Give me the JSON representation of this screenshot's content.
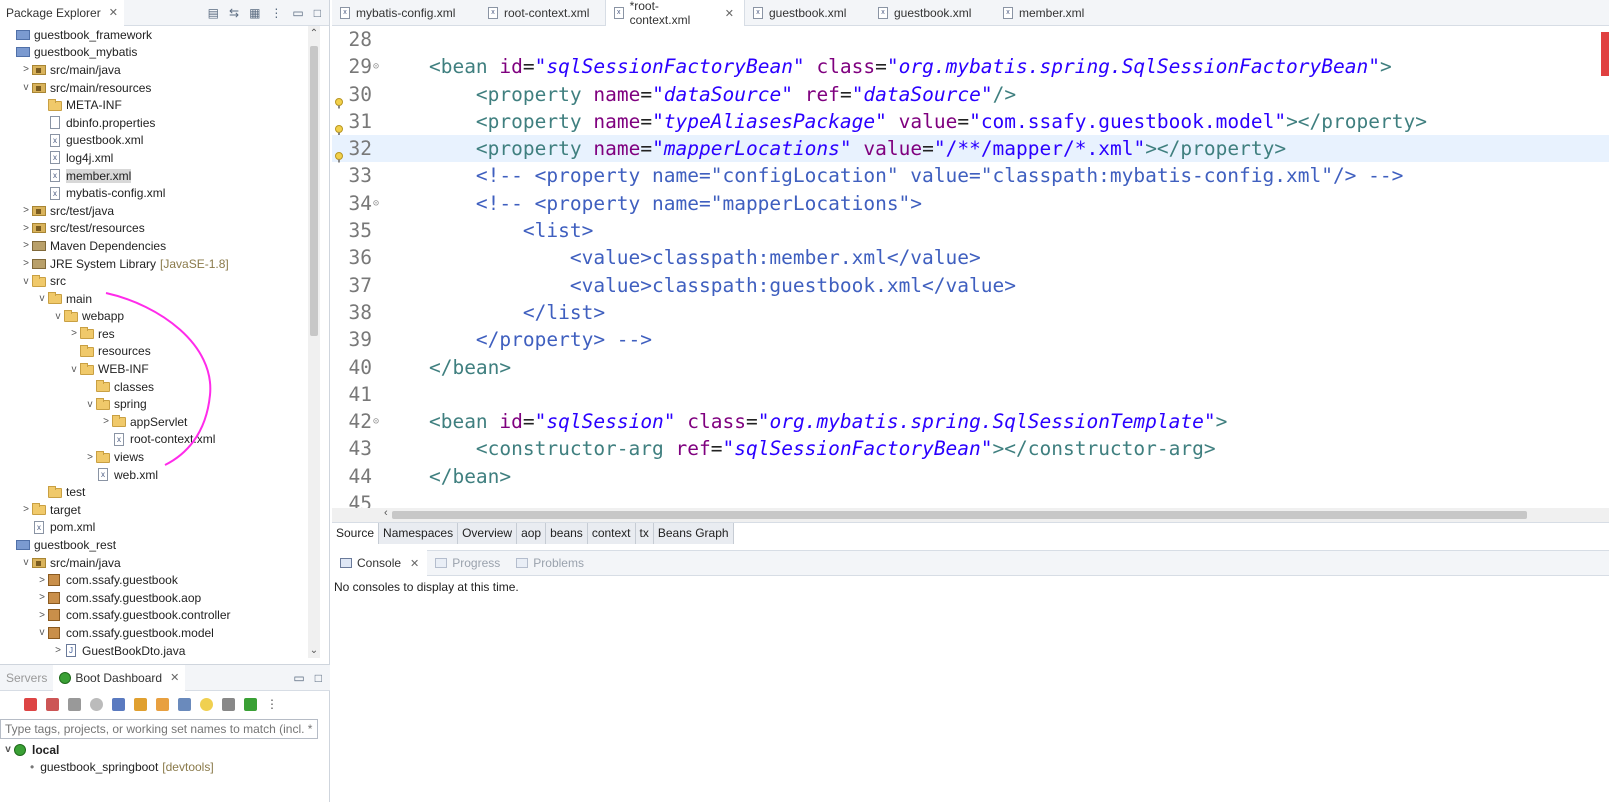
{
  "package_explorer": {
    "tab_label": "Package Explorer",
    "tree": [
      {
        "depth": 0,
        "twisty": "",
        "icon": "project-icon",
        "label": "guestbook_framework"
      },
      {
        "depth": 0,
        "twisty": "",
        "icon": "project-icon",
        "label": "guestbook_mybatis"
      },
      {
        "depth": 1,
        "twisty": ">",
        "icon": "srcfolder-icon",
        "label": "src/main/java"
      },
      {
        "depth": 1,
        "twisty": "v",
        "icon": "srcfolder-icon",
        "label": "src/main/resources"
      },
      {
        "depth": 2,
        "twisty": "",
        "icon": "folder-icon",
        "label": "META-INF"
      },
      {
        "depth": 2,
        "twisty": "",
        "icon": "file-icon",
        "label": "dbinfo.properties"
      },
      {
        "depth": 2,
        "twisty": "",
        "icon": "xml-file-icon",
        "label": "guestbook.xml"
      },
      {
        "depth": 2,
        "twisty": "",
        "icon": "xml-file-icon",
        "label": "log4j.xml"
      },
      {
        "depth": 2,
        "twisty": "",
        "icon": "xml-file-icon",
        "label": "member.xml",
        "selected": true
      },
      {
        "depth": 2,
        "twisty": "",
        "icon": "xml-file-icon",
        "label": "mybatis-config.xml"
      },
      {
        "depth": 1,
        "twisty": ">",
        "icon": "srcfolder-icon",
        "label": "src/test/java"
      },
      {
        "depth": 1,
        "twisty": ">",
        "icon": "srcfolder-icon",
        "label": "src/test/resources"
      },
      {
        "depth": 1,
        "twisty": ">",
        "icon": "library-icon",
        "label": "Maven Dependencies"
      },
      {
        "depth": 1,
        "twisty": ">",
        "icon": "library-icon",
        "label": "JRE System Library",
        "decoration": "[JavaSE-1.8]"
      },
      {
        "depth": 1,
        "twisty": "v",
        "icon": "folder-icon",
        "label": "src"
      },
      {
        "depth": 2,
        "twisty": "v",
        "icon": "folder-icon",
        "label": "main"
      },
      {
        "depth": 3,
        "twisty": "v",
        "icon": "folder-icon",
        "label": "webapp"
      },
      {
        "depth": 4,
        "twisty": ">",
        "icon": "folder-icon",
        "label": "res"
      },
      {
        "depth": 4,
        "twisty": "",
        "icon": "folder-icon",
        "label": "resources"
      },
      {
        "depth": 4,
        "twisty": "v",
        "icon": "folder-icon",
        "label": "WEB-INF"
      },
      {
        "depth": 5,
        "twisty": "",
        "icon": "folder-icon",
        "label": "classes"
      },
      {
        "depth": 5,
        "twisty": "v",
        "icon": "folder-icon",
        "label": "spring"
      },
      {
        "depth": 6,
        "twisty": ">",
        "icon": "folder-icon",
        "label": "appServlet"
      },
      {
        "depth": 6,
        "twisty": "",
        "icon": "xml-file-icon",
        "label": "root-context.xml"
      },
      {
        "depth": 5,
        "twisty": ">",
        "icon": "folder-icon",
        "label": "views"
      },
      {
        "depth": 5,
        "twisty": "",
        "icon": "xml-file-icon",
        "label": "web.xml"
      },
      {
        "depth": 2,
        "twisty": "",
        "icon": "folder-icon",
        "label": "test"
      },
      {
        "depth": 1,
        "twisty": ">",
        "icon": "folder-icon",
        "label": "target"
      },
      {
        "depth": 1,
        "twisty": "",
        "icon": "xml-file-icon",
        "label": "pom.xml"
      },
      {
        "depth": 0,
        "twisty": "",
        "icon": "project-icon",
        "label": "guestbook_rest"
      },
      {
        "depth": 1,
        "twisty": "v",
        "icon": "srcfolder-icon",
        "label": "src/main/java"
      },
      {
        "depth": 2,
        "twisty": ">",
        "icon": "package-icon",
        "label": "com.ssafy.guestbook"
      },
      {
        "depth": 2,
        "twisty": ">",
        "icon": "package-icon",
        "label": "com.ssafy.guestbook.aop"
      },
      {
        "depth": 2,
        "twisty": ">",
        "icon": "package-icon",
        "label": "com.ssafy.guestbook.controller"
      },
      {
        "depth": 2,
        "twisty": "v",
        "icon": "package-icon",
        "label": "com.ssafy.guestbook.model"
      },
      {
        "depth": 3,
        "twisty": ">",
        "icon": "java-file-icon",
        "label": "GuestBookDto.java"
      }
    ]
  },
  "bottom_left": {
    "servers_tab": "Servers",
    "boot_tab": "Boot Dashboard",
    "filter_placeholder": "Type tags, projects, or working set names to match (incl. * and ? wildcards)",
    "local_label": "local",
    "app_label": "guestbook_springboot",
    "app_decoration": "[devtools]"
  },
  "editor_tabs": [
    {
      "label": "mybatis-config.xml",
      "active": false,
      "close": false
    },
    {
      "label": "root-context.xml",
      "active": false,
      "close": false
    },
    {
      "label": "*root-context.xml",
      "active": true,
      "close": true
    },
    {
      "label": "guestbook.xml",
      "active": false,
      "close": false
    },
    {
      "label": "guestbook.xml",
      "active": false,
      "close": false
    },
    {
      "label": "member.xml",
      "active": false,
      "close": false
    }
  ],
  "code_lines": [
    {
      "n": "28",
      "fold": "",
      "html": ""
    },
    {
      "n": "29",
      "fold": "⊝",
      "html": "    <span class='t'>&lt;bean</span> <span class='a'>id</span>=<span class='v'>\"sqlSessionFactoryBean\"</span> <span class='a'>class</span>=<span class='v'>\"org.mybatis.spring.SqlSessionFactoryBean\"</span><span class='t'>&gt;</span>"
    },
    {
      "n": "30",
      "fold": "",
      "marker": true,
      "html": "        <span class='t'>&lt;property</span> <span class='a'>name</span>=<span class='v'>\"dataSource\"</span> <span class='a'>ref</span>=<span class='v'>\"dataSource\"</span><span class='t'>/&gt;</span>"
    },
    {
      "n": "31",
      "fold": "",
      "marker": true,
      "html": "        <span class='t'>&lt;property</span> <span class='a'>name</span>=<span class='v'>\"typeAliasesPackage\"</span> <span class='a'>value</span>=<span class='vn'>\"com.ssafy.guestbook.model\"</span><span class='t'>&gt;&lt;/property&gt;</span>"
    },
    {
      "n": "32",
      "fold": "",
      "marker": true,
      "current": true,
      "html": "        <span class='t'>&lt;property</span> <span class='a'>name</span>=<span class='v'>\"mapperLocations\"</span> <span class='a'>value</span>=<span class='vn'>\"/**/mapper/*.xml\"</span><span class='t'>&gt;&lt;/property&gt;</span>"
    },
    {
      "n": "33",
      "fold": "",
      "html": "        <span class='c'>&lt;!-- &lt;property name=\"configLocation\" value=\"classpath:mybatis-config.xml\"/&gt; --&gt;</span>"
    },
    {
      "n": "34",
      "fold": "⊝",
      "html": "        <span class='c'>&lt;!-- &lt;property name=\"mapperLocations\"&gt;</span>"
    },
    {
      "n": "35",
      "fold": "",
      "html": "            <span class='c'>&lt;list&gt;</span>"
    },
    {
      "n": "36",
      "fold": "",
      "html": "                <span class='c'>&lt;value&gt;classpath:member.xml&lt;/value&gt;</span>"
    },
    {
      "n": "37",
      "fold": "",
      "html": "                <span class='c'>&lt;value&gt;classpath:guestbook.xml&lt;/value&gt;</span>"
    },
    {
      "n": "38",
      "fold": "",
      "html": "            <span class='c'>&lt;/list&gt;</span>"
    },
    {
      "n": "39",
      "fold": "",
      "html": "        <span class='c'>&lt;/property&gt; --&gt;</span>"
    },
    {
      "n": "40",
      "fold": "",
      "html": "    <span class='t'>&lt;/bean&gt;</span>"
    },
    {
      "n": "41",
      "fold": "",
      "html": ""
    },
    {
      "n": "42",
      "fold": "⊝",
      "html": "    <span class='t'>&lt;bean</span> <span class='a'>id</span>=<span class='v'>\"sqlSession\"</span> <span class='a'>class</span>=<span class='v'>\"org.mybatis.spring.SqlSessionTemplate\"</span><span class='t'>&gt;</span>"
    },
    {
      "n": "43",
      "fold": "",
      "html": "        <span class='t'>&lt;constructor-arg</span> <span class='a'>ref</span>=<span class='v'>\"sqlSessionFactoryBean\"</span><span class='t'>&gt;&lt;/constructor-arg&gt;</span>"
    },
    {
      "n": "44",
      "fold": "",
      "html": "    <span class='t'>&lt;/bean&gt;</span>"
    },
    {
      "n": "45",
      "fold": "",
      "html": ""
    }
  ],
  "editor_subtabs": [
    "Source",
    "Namespaces",
    "Overview",
    "aop",
    "beans",
    "context",
    "tx",
    "Beans Graph"
  ],
  "console": {
    "tabs": [
      {
        "label": "Console",
        "active": true
      },
      {
        "label": "Progress",
        "active": false
      },
      {
        "label": "Problems",
        "active": false
      }
    ],
    "message": "No consoles to display at this time."
  }
}
